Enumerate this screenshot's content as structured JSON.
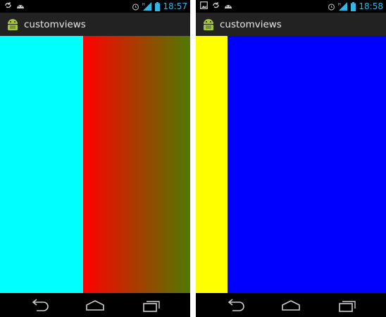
{
  "screens": [
    {
      "status_bar": {
        "time": "18:57",
        "icons": [
          "sync-icon",
          "android-notification-icon",
          "alarm-icon",
          "signal-icon",
          "battery-icon"
        ]
      },
      "app_title": "customviews",
      "content": {
        "blocks": [
          {
            "name": "cyan-view",
            "color": "#00ffff"
          },
          {
            "name": "gradient-view",
            "gradient_from": "#ff0000",
            "gradient_to": "#4f7a00"
          }
        ]
      },
      "nav_buttons": [
        "back-icon",
        "home-icon",
        "recents-icon"
      ]
    },
    {
      "status_bar": {
        "time": "18:58",
        "icons": [
          "picture-icon",
          "sync-icon",
          "android-notification-icon",
          "alarm-icon",
          "signal-icon",
          "battery-icon"
        ]
      },
      "app_title": "customviews",
      "content": {
        "blocks": [
          {
            "name": "yellow-view",
            "color": "#ffff00"
          },
          {
            "name": "blue-view",
            "color": "#0000ff"
          }
        ]
      },
      "nav_buttons": [
        "back-icon",
        "home-icon",
        "recents-icon"
      ]
    }
  ],
  "colors": {
    "accent_time": "#33b5e5",
    "action_bar": "#222222",
    "android_green": "#a4c639"
  }
}
